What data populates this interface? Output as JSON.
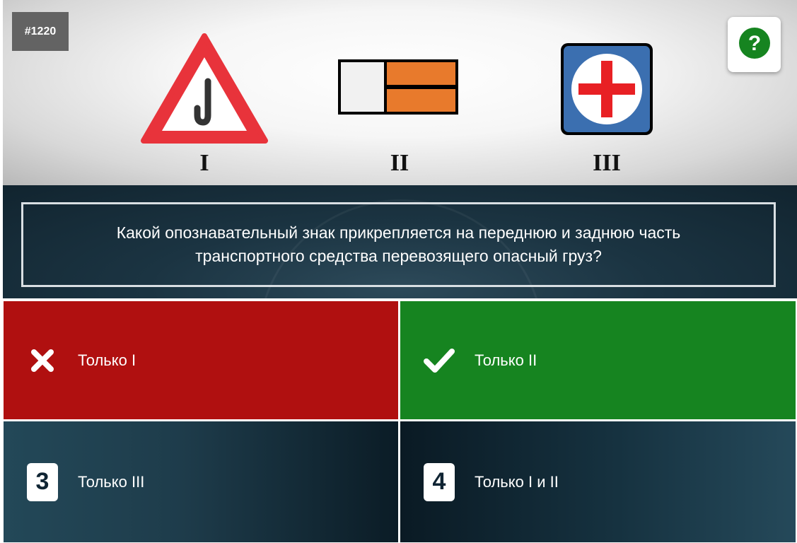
{
  "question_id": "#1220",
  "help_button": {
    "icon": "question-mark-icon",
    "glyph": "?",
    "color": "#168420"
  },
  "signs": [
    {
      "numeral": "I",
      "icon": "warning-triangle-sign-icon"
    },
    {
      "numeral": "II",
      "icon": "orange-plate-sign-icon"
    },
    {
      "numeral": "III",
      "icon": "red-cross-sign-icon"
    }
  ],
  "question": "Какой опознавательный знак прикрепляется на переднюю и заднюю часть транспортного средства перевозящего опасный груз?",
  "answers": [
    {
      "marker": "cross-icon",
      "text": "Только I",
      "state": "wrong",
      "color": "#b01010"
    },
    {
      "marker": "check-icon",
      "text": "Только II",
      "state": "correct",
      "color": "#168420"
    },
    {
      "marker": "3",
      "text": "Только III",
      "state": "neutral"
    },
    {
      "marker": "4",
      "text": "Только I и II",
      "state": "neutral"
    }
  ]
}
